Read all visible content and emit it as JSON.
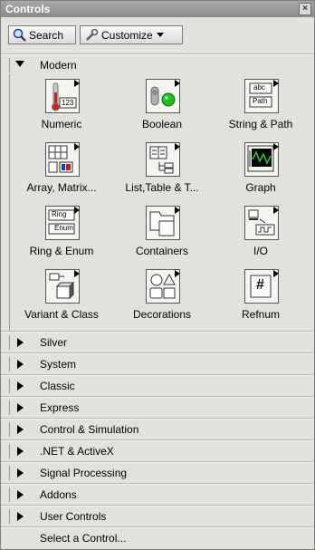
{
  "window": {
    "title": "Controls",
    "close_glyph": "×"
  },
  "toolbar": {
    "search_label": "Search",
    "customize_label": "Customize"
  },
  "categories": {
    "modern": {
      "label": "Modern",
      "items": [
        {
          "label": "Numeric",
          "icon": "numeric-icon"
        },
        {
          "label": "Boolean",
          "icon": "boolean-icon"
        },
        {
          "label": "String & Path",
          "icon": "string-path-icon"
        },
        {
          "label": "Array, Matrix...",
          "icon": "array-matrix-icon"
        },
        {
          "label": "List,Table & T...",
          "icon": "list-table-tree-icon"
        },
        {
          "label": "Graph",
          "icon": "graph-icon"
        },
        {
          "label": "Ring & Enum",
          "icon": "ring-enum-icon"
        },
        {
          "label": "Containers",
          "icon": "containers-icon"
        },
        {
          "label": "I/O",
          "icon": "io-icon"
        },
        {
          "label": "Variant & Class",
          "icon": "variant-class-icon"
        },
        {
          "label": "Decorations",
          "icon": "decorations-icon"
        },
        {
          "label": "Refnum",
          "icon": "refnum-icon"
        }
      ]
    },
    "collapsed": [
      {
        "label": "Silver"
      },
      {
        "label": "System"
      },
      {
        "label": "Classic"
      },
      {
        "label": "Express"
      },
      {
        "label": "Control & Simulation"
      },
      {
        "label": ".NET & ActiveX"
      },
      {
        "label": "Signal Processing"
      },
      {
        "label": "Addons"
      },
      {
        "label": "User Controls"
      }
    ]
  },
  "select_control": {
    "label": "Select a Control..."
  },
  "icon_text": {
    "numeric": "123",
    "string_abc": "abc",
    "string_path": "Path",
    "ring": "Ring",
    "enum": "Enum",
    "refnum": "#"
  }
}
